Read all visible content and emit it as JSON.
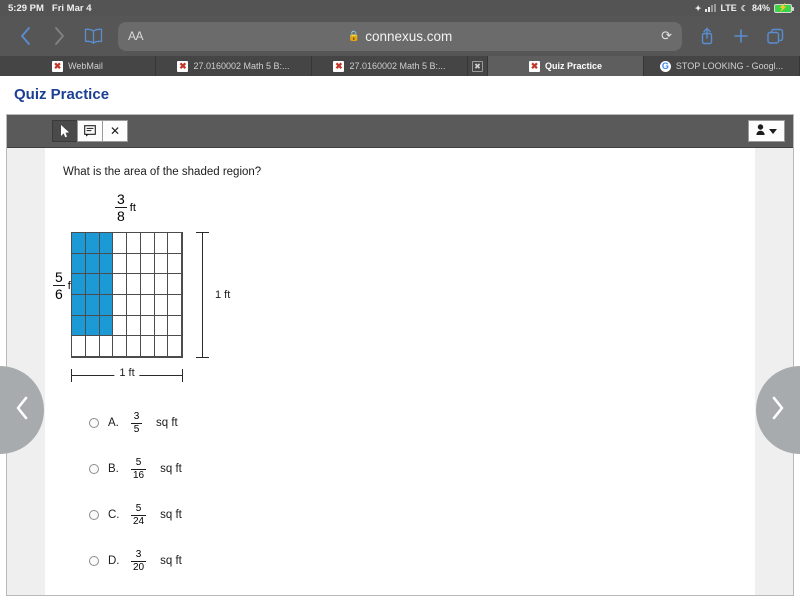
{
  "status_bar": {
    "time": "5:29 PM",
    "date": "Fri Mar 4",
    "network": "LTE",
    "battery_percent": "84%",
    "wifi_icon": "wifi-icon",
    "signal_icon": "cellular-signal-icon",
    "moon_icon": "do-not-disturb-icon",
    "battery_icon": "battery-charging-icon"
  },
  "browser": {
    "back_icon": "back-chevron-icon",
    "forward_icon": "forward-chevron-icon",
    "bookmarks_icon": "book-icon",
    "text_size_label": "AA",
    "lock_icon": "lock-icon",
    "url": "connexus.com",
    "reload_icon": "reload-icon",
    "share_icon": "share-icon",
    "newtab_icon": "plus-icon",
    "tabs_icon": "tabs-overview-icon",
    "tabs": [
      {
        "label": "WebMail",
        "favicon": "connexus-favicon",
        "active": false
      },
      {
        "label": "27.0160002 Math 5 B:...",
        "favicon": "connexus-favicon",
        "active": false
      },
      {
        "label": "27.0160002 Math 5 B:...",
        "favicon": "connexus-favicon",
        "active": false
      },
      {
        "label": "Quiz Practice",
        "favicon": "connexus-favicon",
        "active": true
      },
      {
        "label": "STOP LOOKING - Googl...",
        "favicon": "google-favicon",
        "active": false
      }
    ],
    "tab_close_icon": "close-icon"
  },
  "page": {
    "title": "Quiz Practice",
    "toolbar": {
      "pointer_icon": "cursor-pointer-icon",
      "note_icon": "sticky-note-icon",
      "close_icon": "close-icon",
      "user_icon": "user-icon",
      "user_caret_icon": "caret-down-icon"
    },
    "question": "What is the area of the shaded region?",
    "figure": {
      "top_label": {
        "numerator": "3",
        "denominator": "8",
        "unit": "ft"
      },
      "left_label": {
        "numerator": "5",
        "denominator": "6",
        "unit": "ft"
      },
      "right_dimension": "1 ft",
      "bottom_dimension": "1 ft",
      "grid": {
        "columns": 8,
        "rows": 6,
        "shaded_columns": 3,
        "shaded_rows": 5,
        "shade_color": "#1b9ad6"
      }
    },
    "choices": [
      {
        "letter": "A.",
        "numerator": "3",
        "denominator": "5",
        "unit": "sq ft",
        "selected": false
      },
      {
        "letter": "B.",
        "numerator": "5",
        "denominator": "16",
        "unit": "sq ft",
        "selected": false
      },
      {
        "letter": "C.",
        "numerator": "5",
        "denominator": "24",
        "unit": "sq ft",
        "selected": false
      },
      {
        "letter": "D.",
        "numerator": "3",
        "denominator": "20",
        "unit": "sq ft",
        "selected": false
      }
    ],
    "nav": {
      "prev_icon": "chevron-left-icon",
      "next_icon": "chevron-right-icon"
    }
  }
}
